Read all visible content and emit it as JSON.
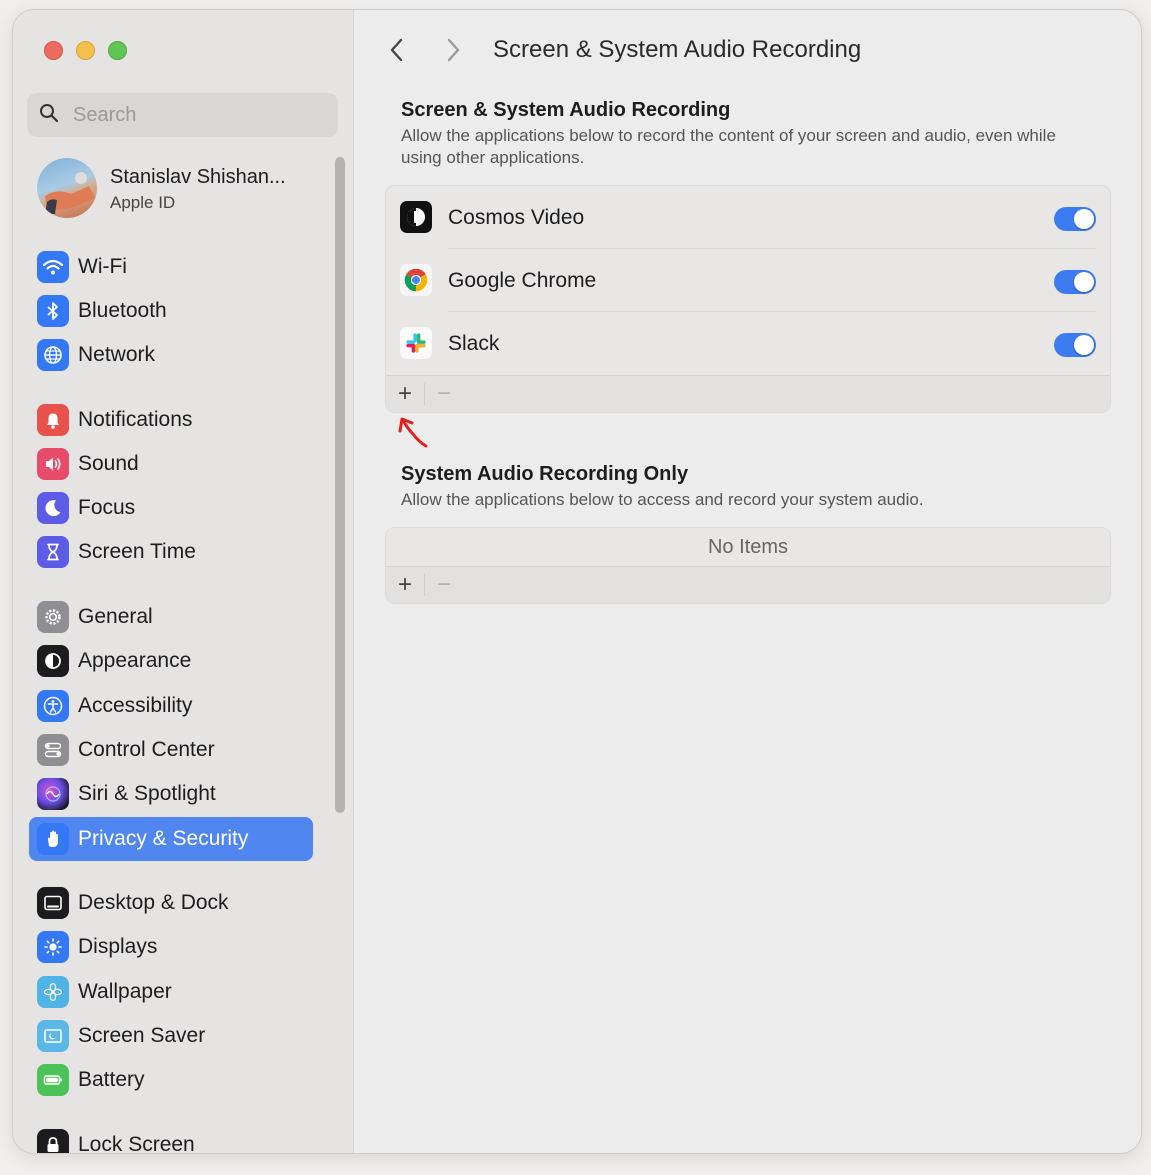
{
  "window": {
    "title": "Screen & System Audio Recording"
  },
  "sidebar": {
    "search_placeholder": "Search",
    "profile": {
      "name": "Stanislav Shishan...",
      "subtitle": "Apple ID"
    },
    "items": [
      {
        "label": "Wi-Fi",
        "icon": "wifi-icon",
        "color": "#3478f6"
      },
      {
        "label": "Bluetooth",
        "icon": "bluetooth-icon",
        "color": "#3478f6"
      },
      {
        "label": "Network",
        "icon": "globe-icon",
        "color": "#3478f6"
      },
      {
        "label": "Notifications",
        "icon": "bell-icon",
        "color": "#e9524a"
      },
      {
        "label": "Sound",
        "icon": "speaker-icon",
        "color": "#e84a6a"
      },
      {
        "label": "Focus",
        "icon": "moon-icon",
        "color": "#5e5ce6"
      },
      {
        "label": "Screen Time",
        "icon": "hourglass-icon",
        "color": "#5e5ce6"
      },
      {
        "label": "General",
        "icon": "gear-icon",
        "color": "#8e8e93"
      },
      {
        "label": "Appearance",
        "icon": "appearance-icon",
        "color": "#1c1c1e"
      },
      {
        "label": "Accessibility",
        "icon": "accessibility-icon",
        "color": "#3478f6"
      },
      {
        "label": "Control Center",
        "icon": "control-center-icon",
        "color": "#8e8e93"
      },
      {
        "label": "Siri & Spotlight",
        "icon": "siri-icon",
        "color": "#3b2a6e"
      },
      {
        "label": "Privacy & Security",
        "icon": "hand-icon",
        "color": "#3478f6",
        "selected": true
      },
      {
        "label": "Desktop & Dock",
        "icon": "dock-icon",
        "color": "#1c1c1e"
      },
      {
        "label": "Displays",
        "icon": "sun-icon",
        "color": "#3478f6"
      },
      {
        "label": "Wallpaper",
        "icon": "flower-icon",
        "color": "#4fb3e8"
      },
      {
        "label": "Screen Saver",
        "icon": "screensaver-icon",
        "color": "#5ab7e6"
      },
      {
        "label": "Battery",
        "icon": "battery-icon",
        "color": "#4cc35a"
      },
      {
        "label": "Lock Screen",
        "icon": "lock-icon",
        "color": "#1c1c1e"
      }
    ]
  },
  "main": {
    "screen_section": {
      "title": "Screen & System Audio Recording",
      "description": "Allow the applications below to record the content of your screen and audio, even while using other applications.",
      "apps": [
        {
          "name": "Cosmos Video",
          "icon": "cosmos-video-icon",
          "enabled": true
        },
        {
          "name": "Google Chrome",
          "icon": "chrome-icon",
          "enabled": true
        },
        {
          "name": "Slack",
          "icon": "slack-icon",
          "enabled": true
        }
      ],
      "add_label": "+",
      "remove_label": "−"
    },
    "audio_section": {
      "title": "System Audio Recording Only",
      "description": "Allow the applications below to access and record your system audio.",
      "empty_text": "No Items",
      "add_label": "+",
      "remove_label": "−"
    }
  },
  "colors": {
    "accent": "#3d7cf0",
    "selection": "#4f86ef",
    "annotation": "#e0201e"
  }
}
